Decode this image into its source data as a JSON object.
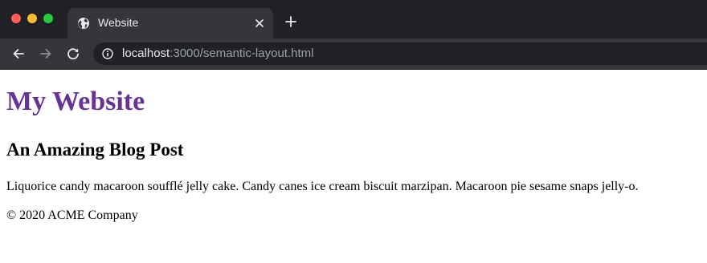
{
  "browser": {
    "tab": {
      "title": "Website",
      "favicon": "globe-icon"
    },
    "address_bar": {
      "host": "localhost",
      "path": ":3000/semantic-layout.html",
      "security_icon": "info-icon"
    },
    "colors": {
      "tabstrip": "#202124",
      "toolbar": "#35363a",
      "omnibox": "#202124",
      "traffic_red": "#ff5f57",
      "traffic_yellow": "#febc2e",
      "traffic_green": "#28c840"
    }
  },
  "page": {
    "site_title": "My Website",
    "site_title_color": "#663399",
    "post_title": "An Amazing Blog Post",
    "post_body": "Liquorice candy macaroon soufflé jelly cake. Candy canes ice cream biscuit marzipan. Macaroon pie sesame snaps jelly-o.",
    "footer": "© 2020 ACME Company"
  }
}
